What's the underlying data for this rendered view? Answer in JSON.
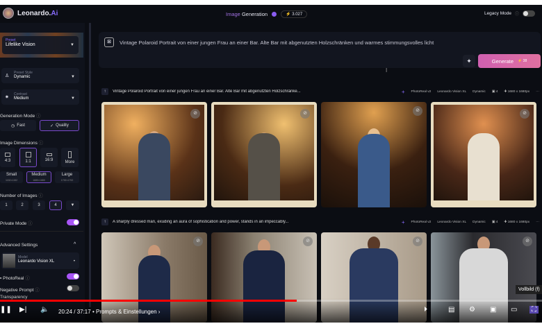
{
  "header": {
    "logo_text": "Leonardo.",
    "logo_ai": "Ai",
    "title_prefix": "Image",
    "title": "Generation",
    "credits": "3.027",
    "legacy_mode": "Legacy Mode"
  },
  "sidebar": {
    "preset": {
      "label": "Preset",
      "value": "Lifelike Vision"
    },
    "preset_style": {
      "label": "Preset Style",
      "value": "Dynamic"
    },
    "contrast": {
      "label": "Contrast",
      "value": "Medium"
    },
    "generation_mode": {
      "label": "Generation Mode",
      "fast": "Fast",
      "quality": "Quality"
    },
    "image_dimensions": {
      "label": "Image Dimensions",
      "ratios": [
        "4:3",
        "1:1",
        "16:9",
        "More"
      ],
      "sizes": [
        {
          "label": "Small",
          "sub": "1152×1152"
        },
        {
          "label": "Medium",
          "sub": "1680×1680"
        },
        {
          "label": "Large",
          "sub": "1792×1792"
        }
      ]
    },
    "number_of_images": {
      "label": "Number of Images",
      "options": [
        "1",
        "2",
        "3",
        "4"
      ]
    },
    "private_mode": "Private Mode",
    "advanced_settings": "Advanced Settings",
    "model": {
      "label": "Model",
      "value": "Leonardo Vision XL"
    },
    "photoreal": "PhotoReal",
    "negative_prompt": "Negative Prompt",
    "transparency": "Transparency"
  },
  "prompt": {
    "text": "Vintage Polaroid Portrait von einer jungen Frau an einer Bar. Alte Bar mit abgenutzten Holzschränken und warmes stimmungsvolles licht",
    "generate": "Generate",
    "generate_cost": "38"
  },
  "generations": [
    {
      "prompt": "Vintage Polaroid Portrait von einer jungen Frau an einer Bar. Alte Bar mit abgenutzten Holzschränke...",
      "tags": [
        "PhotoReal v2",
        "Leonardo Vision XL",
        "Dynamic",
        "4",
        "1680 x 1680px"
      ]
    },
    {
      "prompt": "A sharply dressed man, exuding an aura of sophistication and power, stands in an impeccably...",
      "tags": [
        "PhotoReal v2",
        "Leonardo Vision XL",
        "Dynamic",
        "4",
        "1680 x 1680px"
      ]
    }
  ],
  "player": {
    "time": "20:24 / 37:17",
    "chapter": "• Prompts & Einstellungen",
    "progress": 0.547,
    "tooltip": "Vollbild (f)"
  },
  "colors": {
    "accent": "#8a5cf0",
    "generate": "#e070a0",
    "progress": "#ff0000"
  }
}
